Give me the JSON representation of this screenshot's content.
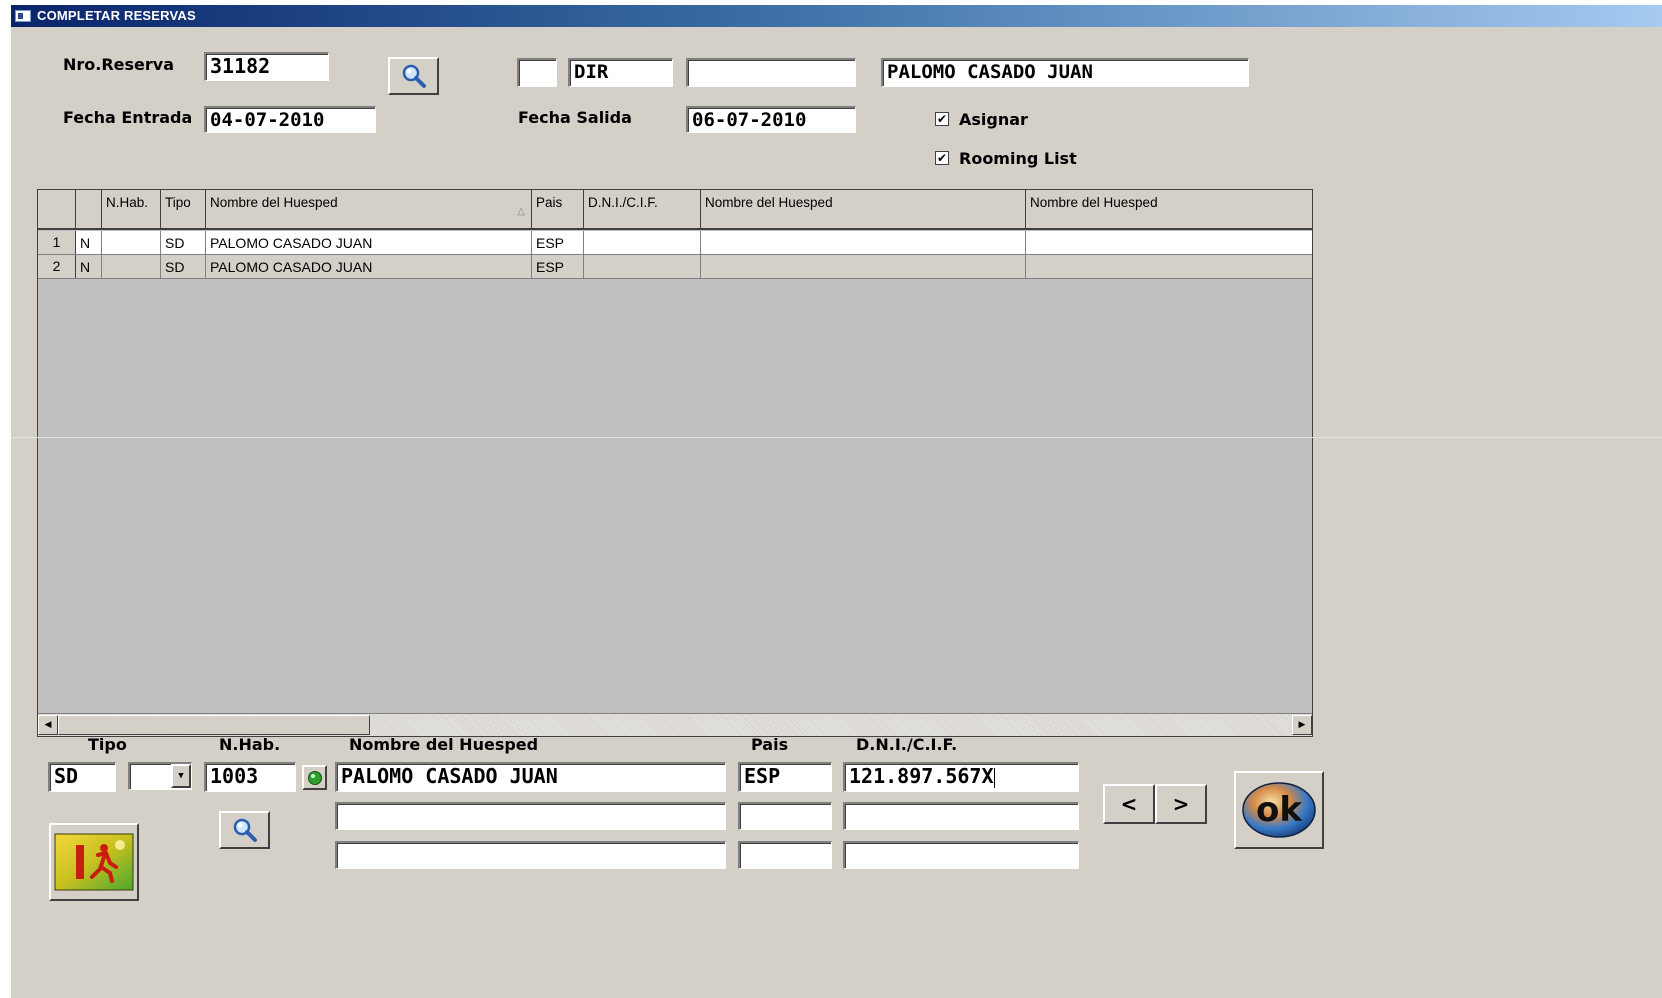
{
  "window": {
    "title": "COMPLETAR RESERVAS"
  },
  "header": {
    "nro_reserva_label": "Nro.Reserva",
    "nro_reserva_value": "31182",
    "code1_value": "",
    "code2_value": "DIR",
    "code3_value": "",
    "client_name_value": "PALOMO CASADO JUAN",
    "fecha_entrada_label": "Fecha Entrada",
    "fecha_entrada_value": "04-07-2010",
    "fecha_salida_label": "Fecha Salida",
    "fecha_salida_value": "06-07-2010",
    "asignar_label": "Asignar",
    "asignar_checked": true,
    "rooming_label": "Rooming List",
    "rooming_checked": true
  },
  "grid": {
    "columns": [
      "",
      "",
      "N.Hab.",
      "Tipo",
      "Nombre del Huesped",
      "Pais",
      "D.N.I./C.I.F.",
      "Nombre del Huesped",
      "Nombre del Huesped"
    ],
    "rows": [
      {
        "num": "1",
        "flag": "N",
        "nhab": "",
        "tipo": "SD",
        "nombre": "PALOMO CASADO JUAN",
        "pais": "ESP",
        "dni": "",
        "nombre2": "",
        "nombre3": ""
      },
      {
        "num": "2",
        "flag": "N",
        "nhab": "",
        "tipo": "SD",
        "nombre": "PALOMO CASADO JUAN",
        "pais": "ESP",
        "dni": "",
        "nombre2": "",
        "nombre3": ""
      }
    ]
  },
  "detail": {
    "tipo_label": "Tipo",
    "nhab_label": "N.Hab.",
    "nombre_label": "Nombre del Huesped",
    "pais_label": "Pais",
    "dni_label": "D.N.I./C.I.F.",
    "tipo_value": "SD",
    "tipo_select_value": "",
    "nhab_value": "1003",
    "nombre_values": [
      "PALOMO CASADO JUAN",
      "",
      ""
    ],
    "pais_values": [
      "ESP",
      "",
      ""
    ],
    "dni_values": [
      "121.897.567X",
      "",
      ""
    ]
  },
  "buttons": {
    "prev_label": "<",
    "next_label": ">",
    "ok_label": "ok"
  },
  "icons": {
    "search": "magnifier-icon",
    "exit": "exit-door-icon",
    "status": "green-led-icon",
    "ok": "ok-icon"
  }
}
